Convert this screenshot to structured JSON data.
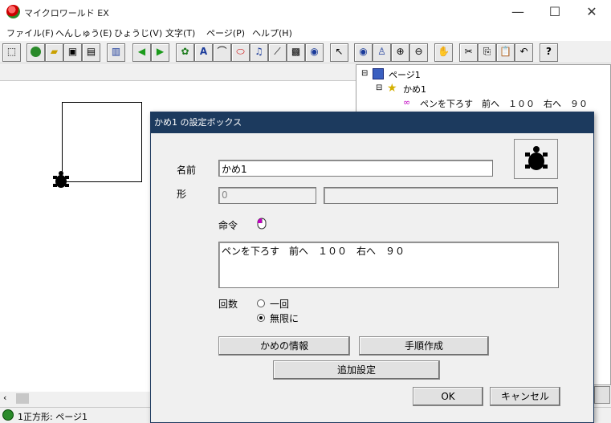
{
  "window": {
    "title": "マイクロワールド EX",
    "minimize": "—",
    "maximize": "☐",
    "close": "✕"
  },
  "menu": [
    "ファイル(F)",
    "へんしゅう(E)",
    "ひょうじ(V)",
    "文字(T)",
    "ページ(P)",
    "ヘルプ(H)"
  ],
  "toolbar": {
    "icons": [
      "select-box-icon",
      "globe-icon",
      "open-folder-icon",
      "save-icon",
      "print-icon",
      "layout-icon",
      "back-arrow-icon",
      "forward-arrow-icon",
      "turtle-hatch-icon",
      "text-box-icon",
      "paint-icon",
      "shape-icon",
      "music-icon",
      "magic-wand-icon",
      "movie-icon",
      "camera-icon",
      "pointer-icon",
      "eye-icon",
      "stamp-icon",
      "zoom-in-icon",
      "zoom-out-icon",
      "stop-icon",
      "cut-icon",
      "copy-icon",
      "paste-icon",
      "undo-icon",
      "help-icon"
    ]
  },
  "tree": {
    "page": "ページ1",
    "turtle": "かめ1",
    "command": "ペンを下ろす　前へ　１００　右へ　９０"
  },
  "status": {
    "text": "1正方形: ページ1"
  },
  "dialog": {
    "title": "かめ1 の設定ボックス",
    "name_label": "名前",
    "name_value": "かめ1",
    "shape_label": "形",
    "shape_value": "0",
    "command_label": "命令",
    "command_text": "ペンを下ろす　前へ　１００　右へ　９０",
    "count_label": "回数",
    "once_label": "一回",
    "forever_label": "無限に",
    "selected_count": "forever",
    "info_button": "かめの情報",
    "procedure_button": "手順作成",
    "extra_button": "追加設定",
    "ok_button": "OK",
    "cancel_button": "キャンセル"
  }
}
